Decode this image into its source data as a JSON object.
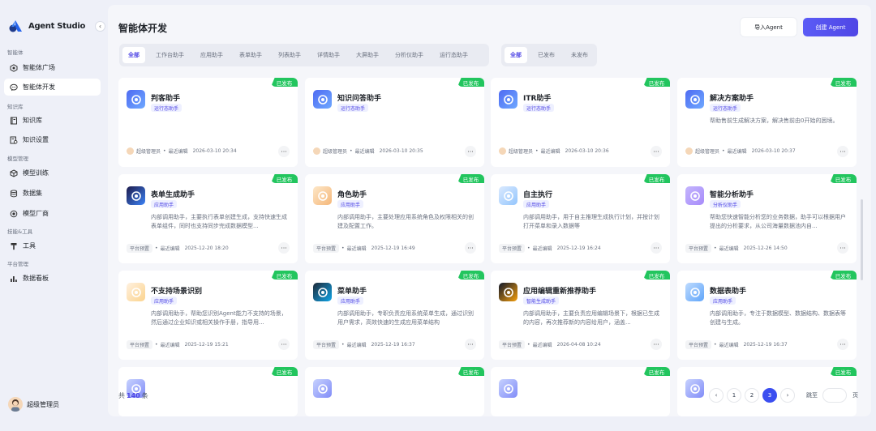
{
  "app": {
    "name": "Agent Studio"
  },
  "sidebar": {
    "groups": [
      {
        "label": "智能体"
      },
      {
        "label": "知识库"
      },
      {
        "label": "模型管理"
      },
      {
        "label": "技能&工具"
      },
      {
        "label": "平台管理"
      }
    ],
    "items": [
      {
        "label": "智能体广场",
        "icon": "compass-icon"
      },
      {
        "label": "智能体开发",
        "icon": "chat-icon"
      },
      {
        "label": "知识库",
        "icon": "book-icon"
      },
      {
        "label": "知识设置",
        "icon": "settings-doc-icon"
      },
      {
        "label": "模型训练",
        "icon": "cube-icon"
      },
      {
        "label": "数据集",
        "icon": "database-icon"
      },
      {
        "label": "模型厂商",
        "icon": "vendor-icon"
      },
      {
        "label": "工具",
        "icon": "hammer-icon"
      },
      {
        "label": "数据看板",
        "icon": "chart-icon"
      }
    ],
    "user": {
      "name": "超级管理员"
    }
  },
  "header": {
    "title": "智能体开发",
    "import_label": "导入Agent",
    "create_label": "创建 Agent"
  },
  "category_tabs": [
    "全部",
    "工作台助手",
    "应用助手",
    "表单助手",
    "列表助手",
    "详情助手",
    "大屏助手",
    "分析仪助手",
    "运行态助手"
  ],
  "status_tabs": [
    "全部",
    "已发布",
    "未发布"
  ],
  "cards": [
    {
      "title": "判客助手",
      "tag": "运行态助手",
      "desc": "",
      "owner": "超级管理员",
      "edited_label": "最近编辑",
      "time": "2026-03-10 20:34",
      "badge": "已发布"
    },
    {
      "title": "知识问答助手",
      "tag": "运行态助手",
      "desc": "",
      "owner": "超级管理员",
      "edited_label": "最近编辑",
      "time": "2026-03-10 20:35",
      "badge": "已发布"
    },
    {
      "title": "ITR助手",
      "tag": "运行态助手",
      "desc": "",
      "owner": "超级管理员",
      "edited_label": "最近编辑",
      "time": "2026-03-10 20:36",
      "badge": "已发布"
    },
    {
      "title": "解决方案助手",
      "tag": "运行态助手",
      "desc": "帮助售前生成解决方案，解决售前由0开始的困境。",
      "owner": "超级管理员",
      "edited_label": "最近编辑",
      "time": "2026-03-10 20:37",
      "badge": "已发布"
    },
    {
      "title": "表单生成助手",
      "tag": "应用助手",
      "desc": "内部调用助手，主要执行表单创建生成，支持快速生成表单组件，同时也支持同步完成数据模型...",
      "owner": "平台预置",
      "edited_label": "最近编辑",
      "time": "2025-12-20 18:20",
      "badge": "已发布"
    },
    {
      "title": "角色助手",
      "tag": "应用助手",
      "desc": "内部调用助手，主要处理应用系统角色及权限相关的创建及配置工作。",
      "owner": "平台预置",
      "edited_label": "最近编辑",
      "time": "2025-12-19 16:49",
      "badge": "已发布"
    },
    {
      "title": "自主执行",
      "tag": "应用助手",
      "desc": "内部调用助手，用于自主推理生成执行计划，并按计划打开菜单和录入数据等",
      "owner": "平台预置",
      "edited_label": "最近编辑",
      "time": "2025-12-19 16:24",
      "badge": "已发布"
    },
    {
      "title": "智能分析助手",
      "tag": "分析仪助手",
      "desc": "帮助您快速智能分析您的业务数据，助手可以根据用户提出的分析要求，从公司海量数据池内自...",
      "owner": "平台预置",
      "edited_label": "最近编辑",
      "time": "2025-12-26 14:50",
      "badge": "已发布"
    },
    {
      "title": "不支持场景识别",
      "tag": "应用助手",
      "desc": "内部调用助手，帮助您识别Agent能力不支持的场景，然后通过企业知识或相关操作手册，指导用...",
      "owner": "平台预置",
      "edited_label": "最近编辑",
      "time": "2025-12-19 15:21",
      "badge": "已发布"
    },
    {
      "title": "菜单助手",
      "tag": "应用助手",
      "desc": "内部调用助手，专职负责应用系统菜单生成，通过识别用户需求，高效快速的生成应用菜单结构",
      "owner": "平台预置",
      "edited_label": "最近编辑",
      "time": "2025-12-19 16:37",
      "badge": "已发布"
    },
    {
      "title": "应用编辑重新推荐助手",
      "tag": "智能生成助手",
      "desc": "内部调用助手，主要负责应用编辑场景下，根据已生成的内容，再次推荐新的内容给用户，涵盖...",
      "owner": "平台预置",
      "edited_label": "最近编辑",
      "time": "2026-04-08 10:24",
      "badge": "已发布"
    },
    {
      "title": "数据表助手",
      "tag": "应用助手",
      "desc": "内部调用助手，专注于数据模型、数据结构、数据表等创建与生成。",
      "owner": "平台预置",
      "edited_label": "最近编辑",
      "time": "2025-12-19 16:37",
      "badge": "已发布"
    },
    {
      "title": "",
      "tag": "",
      "desc": "",
      "owner": "",
      "edited_label": "",
      "time": "",
      "badge": "已发布"
    },
    {
      "title": "",
      "tag": "",
      "desc": "",
      "owner": "",
      "edited_label": "",
      "time": "",
      "badge": "已发布"
    },
    {
      "title": "",
      "tag": "",
      "desc": "",
      "owner": "",
      "edited_label": "",
      "time": "",
      "badge": "已发布"
    },
    {
      "title": "",
      "tag": "",
      "desc": "",
      "owner": "",
      "edited_label": "",
      "time": "",
      "badge": "已发布"
    }
  ],
  "pagination": {
    "total_prefix": "共",
    "total": "140",
    "total_suffix": "条",
    "pages": [
      "1",
      "2",
      "3"
    ],
    "current": "3",
    "jump_label": "跳至",
    "jump_unit": "页"
  },
  "colors": {
    "accent": "#4f46e5",
    "published": "#22c55e",
    "background": "#eef0f8"
  }
}
